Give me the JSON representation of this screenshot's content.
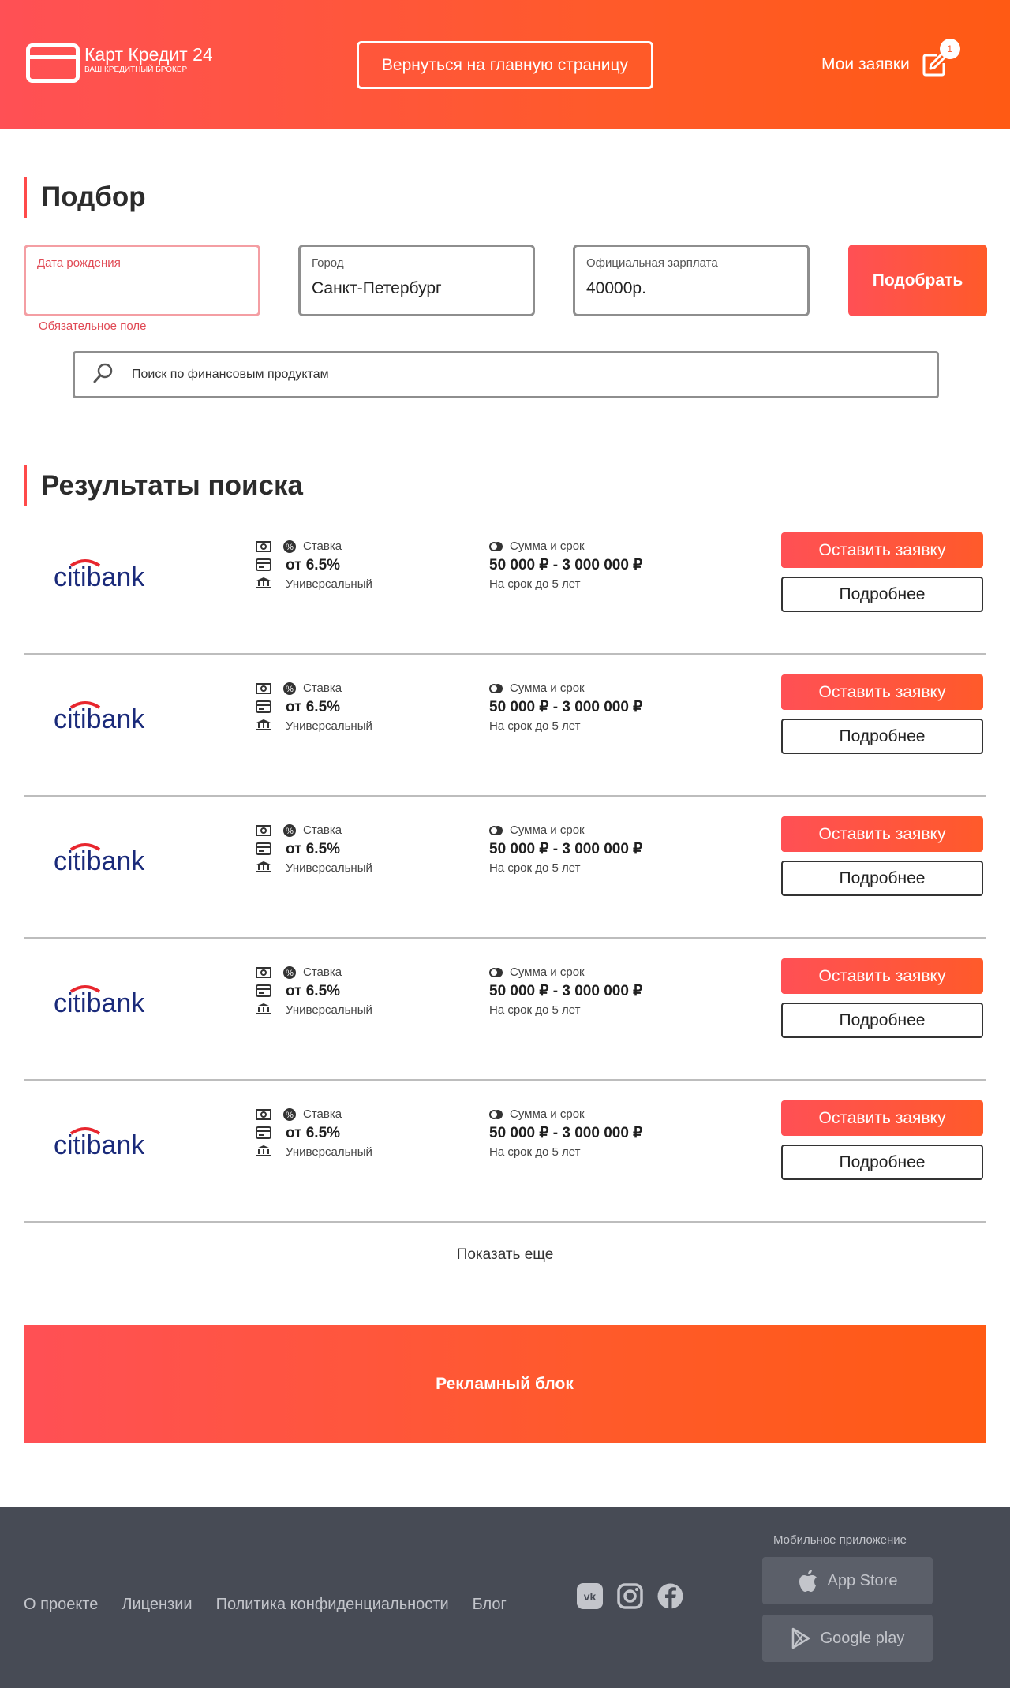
{
  "header": {
    "logo_title": "Карт Кредит 24",
    "logo_subtitle": "ВАШ КРЕДИТНЫЙ БРОКЕР",
    "home_button": "Вернуться на главную страницу",
    "my_apps": "Мои заявки",
    "badge_count": "1"
  },
  "filter": {
    "title": "Подбор",
    "birth_date": {
      "label": "Дата рождения",
      "value": "",
      "hint": "Обязательное поле"
    },
    "city": {
      "label": "Город",
      "value": "Санкт-Петербург"
    },
    "salary": {
      "label": "Официальная зарплата",
      "value": "40000р."
    },
    "pick_button": "Подобрать",
    "search_placeholder": "Поиск по финансовым продуктам"
  },
  "results": {
    "title": "Результаты поиска",
    "items": [
      {
        "bank": "citibank",
        "rate_label": "Ставка",
        "rate": "от 6.5%",
        "type": "Универсальный",
        "sum_label": "Сумма и срок",
        "sum": "50 000 ₽ - 3 000 000 ₽",
        "term": "На срок до 5 лет",
        "apply": "Оставить заявку",
        "more": "Подробнее"
      },
      {
        "bank": "citibank",
        "rate_label": "Ставка",
        "rate": "от 6.5%",
        "type": "Универсальный",
        "sum_label": "Сумма и срок",
        "sum": "50 000 ₽ - 3 000 000 ₽",
        "term": "На срок до 5 лет",
        "apply": "Оставить заявку",
        "more": "Подробнее"
      },
      {
        "bank": "citibank",
        "rate_label": "Ставка",
        "rate": "от 6.5%",
        "type": "Универсальный",
        "sum_label": "Сумма и срок",
        "sum": "50 000 ₽ - 3 000 000 ₽",
        "term": "На срок до 5 лет",
        "apply": "Оставить заявку",
        "more": "Подробнее"
      },
      {
        "bank": "citibank",
        "rate_label": "Ставка",
        "rate": "от 6.5%",
        "type": "Универсальный",
        "sum_label": "Сумма и срок",
        "sum": "50 000 ₽ - 3 000 000 ₽",
        "term": "На срок до 5 лет",
        "apply": "Оставить заявку",
        "more": "Подробнее"
      },
      {
        "bank": "citibank",
        "rate_label": "Ставка",
        "rate": "от 6.5%",
        "type": "Универсальный",
        "sum_label": "Сумма и срок",
        "sum": "50 000 ₽ - 3 000 000 ₽",
        "term": "На срок до 5 лет",
        "apply": "Оставить заявку",
        "more": "Подробнее"
      }
    ],
    "show_more": "Показать еще"
  },
  "ad": {
    "label": "Рекламный блок"
  },
  "footer": {
    "links": [
      "О проекте",
      "Лицензии",
      "Политика конфиденциальности",
      "Блог"
    ],
    "socials": [
      "vk-icon",
      "instagram-icon",
      "facebook-icon"
    ],
    "app_caption": "Мобильное приложение",
    "app_store": "App Store",
    "google_play": "Google play"
  },
  "colors": {
    "accent_start": "#ff5055",
    "accent_end": "#ff5a14",
    "error": "#e04a55",
    "footer_bg": "#474b55",
    "citi_blue": "#1a2a7a",
    "citi_red": "#e8262e"
  }
}
